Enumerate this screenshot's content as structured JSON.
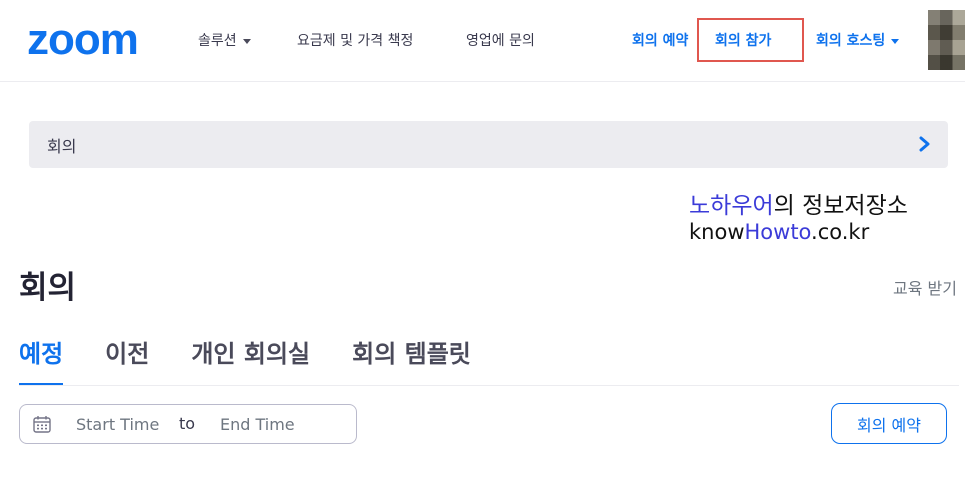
{
  "header": {
    "logo_text": "zoom",
    "nav_left": [
      {
        "label": "솔루션",
        "has_caret": true
      },
      {
        "label": "요금제 및 가격 책정",
        "has_caret": false
      },
      {
        "label": "영업에 문의",
        "has_caret": false
      }
    ],
    "nav_right": {
      "schedule": "회의 예약",
      "join": "회의 참가",
      "host": "회의 호스팅"
    }
  },
  "breadcrumb": {
    "label": "회의"
  },
  "watermark": {
    "line1_blue": "노하우어",
    "line1_rest": "의 정보저장소",
    "line2_pre": "know",
    "line2_blue": "Howto",
    "line2_post": ".co.kr"
  },
  "main": {
    "title": "회의",
    "training_link": "교육 받기",
    "tabs": [
      {
        "label": "예정",
        "active": true
      },
      {
        "label": "이전",
        "active": false
      },
      {
        "label": "개인 회의실",
        "active": false
      },
      {
        "label": "회의 템플릿",
        "active": false
      }
    ],
    "date_range": {
      "start_placeholder": "Start Time",
      "separator": "to",
      "end_placeholder": "End Time"
    },
    "schedule_button": "회의 예약"
  },
  "colors": {
    "brand_blue": "#0e72ed",
    "highlight_red": "#e0574f",
    "watermark_blue": "#3b3bd8"
  },
  "icons": [
    "zoom-logo",
    "chevron-down-icon",
    "chevron-right-icon",
    "calendar-icon",
    "avatar"
  ]
}
